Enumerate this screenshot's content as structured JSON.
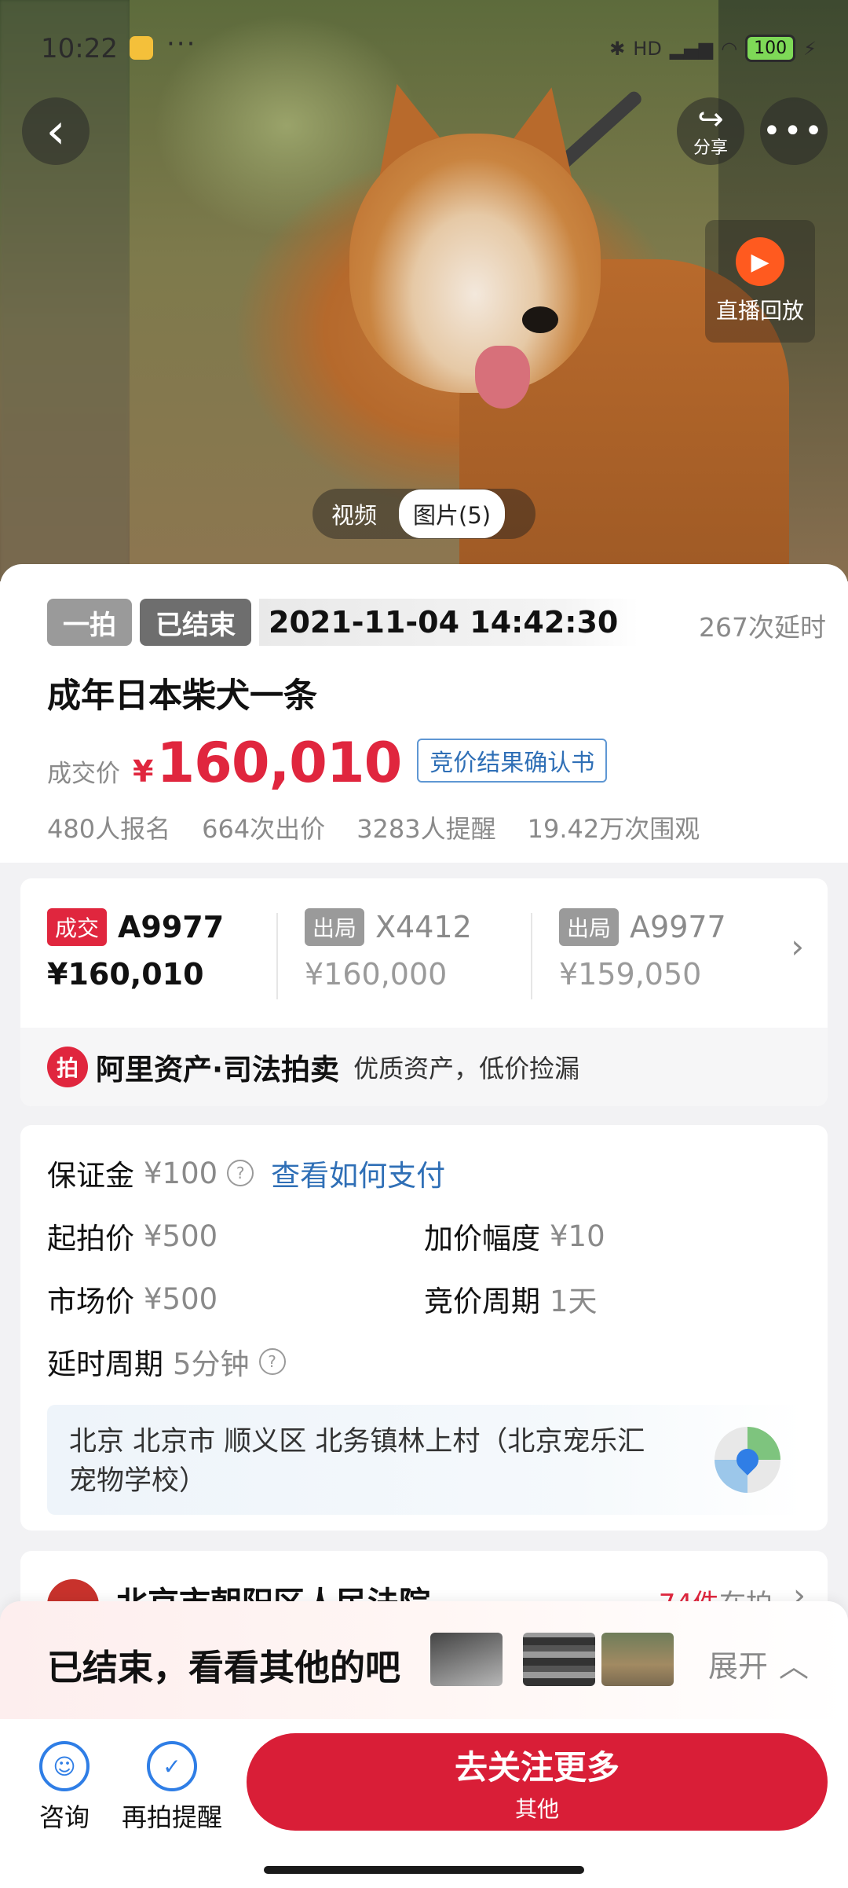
{
  "status_bar": {
    "time": "10:22",
    "dots": "···",
    "network": "HD",
    "battery": "100"
  },
  "hero": {
    "share_label": "分享",
    "live_replay_label": "直播回放",
    "media_tabs": [
      {
        "label": "视频",
        "active": false
      },
      {
        "label": "图片(5)",
        "active": true
      }
    ]
  },
  "auction": {
    "tag_type": "一拍",
    "tag_status": "已结束",
    "end_time": "2021-11-04 14:42:30",
    "delay_count": "267次延时",
    "title": "成年日本柴犬一条",
    "price_label": "成交价",
    "currency": "¥",
    "final_price": "160,010",
    "confirm_link": "竞价结果确认书",
    "stats": [
      "480人报名",
      "664次出价",
      "3283人提醒",
      "19.42万次围观"
    ]
  },
  "bids": [
    {
      "badge": "成交",
      "user": "A9977",
      "price": "¥160,010",
      "winner": true
    },
    {
      "badge": "出局",
      "user": "X4412",
      "price": "¥160,000",
      "winner": false
    },
    {
      "badge": "出局",
      "user": "A9977",
      "price": "¥159,050",
      "winner": false
    }
  ],
  "ali_banner": {
    "logo": "拍",
    "brand": "阿里资产·司法拍卖",
    "slogan": "优质资产，低价捡漏"
  },
  "details": {
    "deposit_label": "保证金",
    "deposit_value": "¥100",
    "pay_link": "查看如何支付",
    "start_price_label": "起拍价",
    "start_price_value": "¥500",
    "increment_label": "加价幅度",
    "increment_value": "¥10",
    "market_price_label": "市场价",
    "market_price_value": "¥500",
    "cycle_label": "竞价周期",
    "cycle_value": "1天",
    "delay_cycle_label": "延时周期",
    "delay_cycle_value": "5分钟",
    "address": "北京 北京市 顺义区 北务镇林上村（北京宠乐汇宠物学校）"
  },
  "court": {
    "name": "北京市朝阳区人民法院",
    "count": "74件",
    "suffix": "在拍"
  },
  "ended_panel": {
    "text": "已结束，看看其他的吧",
    "expand_label": "展开"
  },
  "bottom_bar": {
    "consult_label": "咨询",
    "remind_label": "再拍提醒",
    "follow_main": "去关注更多",
    "follow_sub": "其他"
  },
  "colors": {
    "accent_red": "#e0263e",
    "link_blue": "#2f6fb6",
    "icon_blue": "#2f7ee6",
    "replay_orange": "#ff5a1f"
  }
}
